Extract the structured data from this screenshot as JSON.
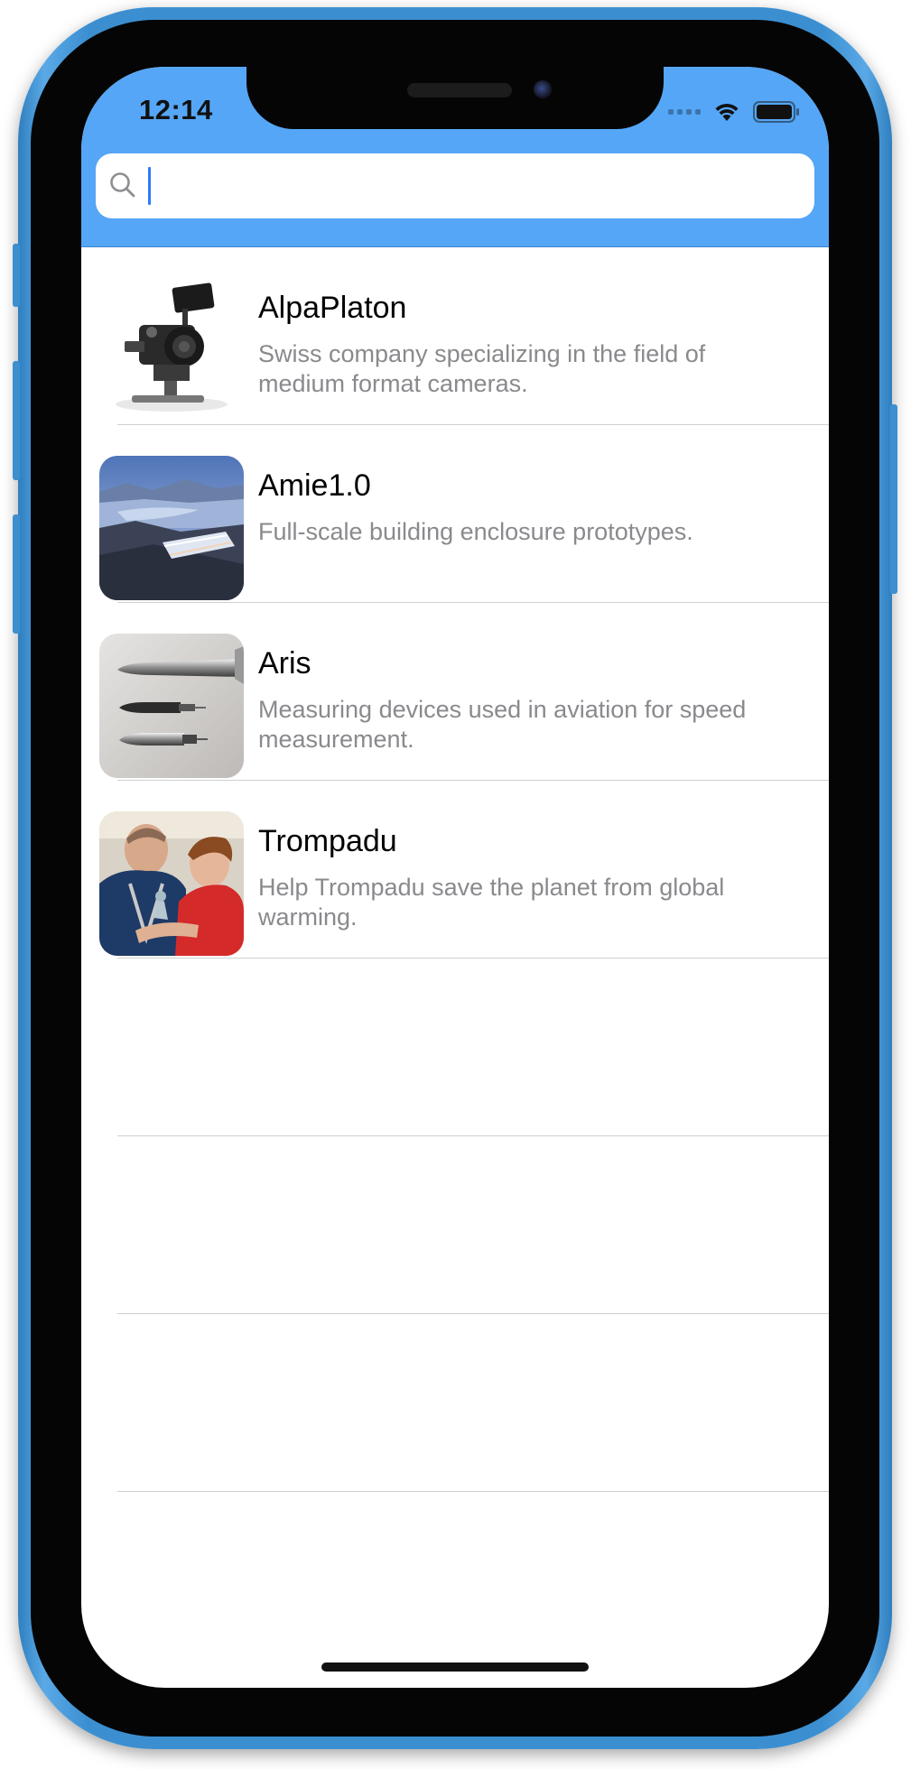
{
  "status_bar": {
    "time": "12:14",
    "icons": [
      "signal-dots-icon",
      "wifi-icon",
      "battery-icon"
    ]
  },
  "search": {
    "value": "",
    "placeholder": "",
    "icon": "search-icon"
  },
  "colors": {
    "header": "#55a6f6",
    "phone_frame": "#3b8fd1",
    "title_text": "#000000",
    "desc_text": "#8a8a8e",
    "caret": "#2d7cf6"
  },
  "items": [
    {
      "title": "AlpaPlaton",
      "description": "Swiss company specializing in the field of medium format cameras.",
      "thumbnail": "camera-rig-photo"
    },
    {
      "title": "Amie1.0",
      "description": "Full-scale building enclosure prototypes.",
      "thumbnail": "mountain-lake-building-photo"
    },
    {
      "title": "Aris",
      "description": "Measuring devices used in aviation for speed measurement.",
      "thumbnail": "pitot-probes-photo"
    },
    {
      "title": "Trompadu",
      "description": "Help Trompadu save the planet from global warming.",
      "thumbnail": "man-and-boy-photo"
    }
  ]
}
